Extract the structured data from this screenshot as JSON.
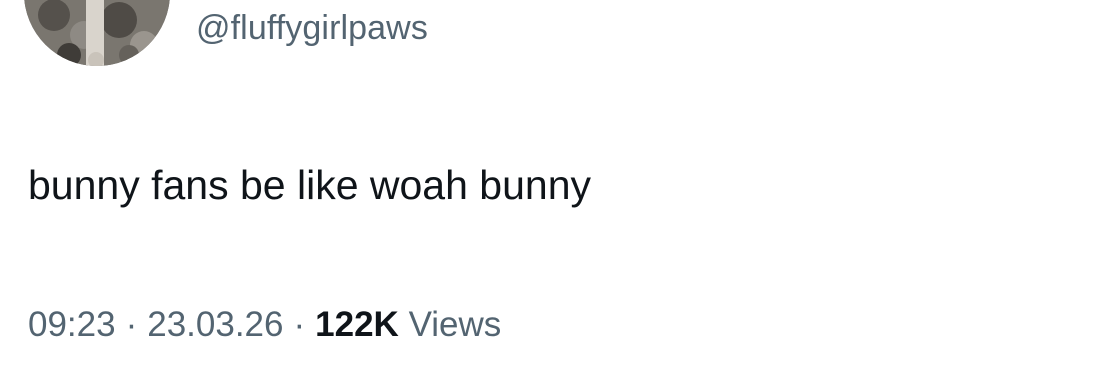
{
  "tweet": {
    "handle": "@fluffygirlpaws",
    "text": "bunny fans be like woah bunny",
    "time": "09:23",
    "date": "23.03.26",
    "separator": "·",
    "views_count": "122K",
    "views_label": "Views",
    "avatar_icon": "profile-avatar"
  }
}
